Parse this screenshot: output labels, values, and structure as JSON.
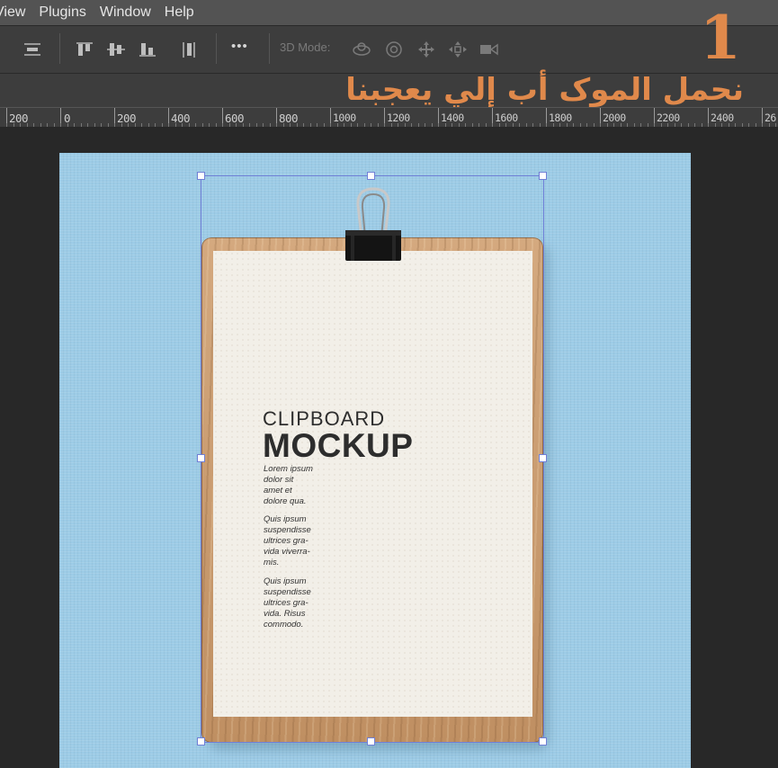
{
  "menubar": {
    "items": [
      "View",
      "Plugins",
      "Window",
      "Help"
    ]
  },
  "options_bar": {
    "mode_label": "3D Mode:",
    "more_label": "•••"
  },
  "annotation": {
    "number": "1",
    "text": "نحمل الموک أب إلي يعجبنا",
    "color": "#e0894b"
  },
  "ruler": {
    "labels": [
      "200",
      "0",
      "200",
      "400",
      "600",
      "800",
      "1000",
      "1200",
      "1400",
      "1600",
      "1800",
      "2000",
      "2200",
      "2400",
      "26"
    ]
  },
  "document": {
    "background_color": "#9ccbe6",
    "mockup": {
      "title_line1": "CLIPBOARD",
      "title_line2": "MOCKUP",
      "para1": [
        "Lorem ipsum",
        "dolor sit",
        "amet et",
        "dolore qua."
      ],
      "para2": [
        "Quis ipsum",
        "suspendisse",
        "ultrices gra-",
        "vida viverra-",
        "mis."
      ],
      "para3": [
        "Quis ipsum",
        "suspendisse",
        "ultrices gra-",
        "vida. Risus",
        "commodo."
      ]
    }
  },
  "selection": {
    "color": "#6f7fd6"
  }
}
